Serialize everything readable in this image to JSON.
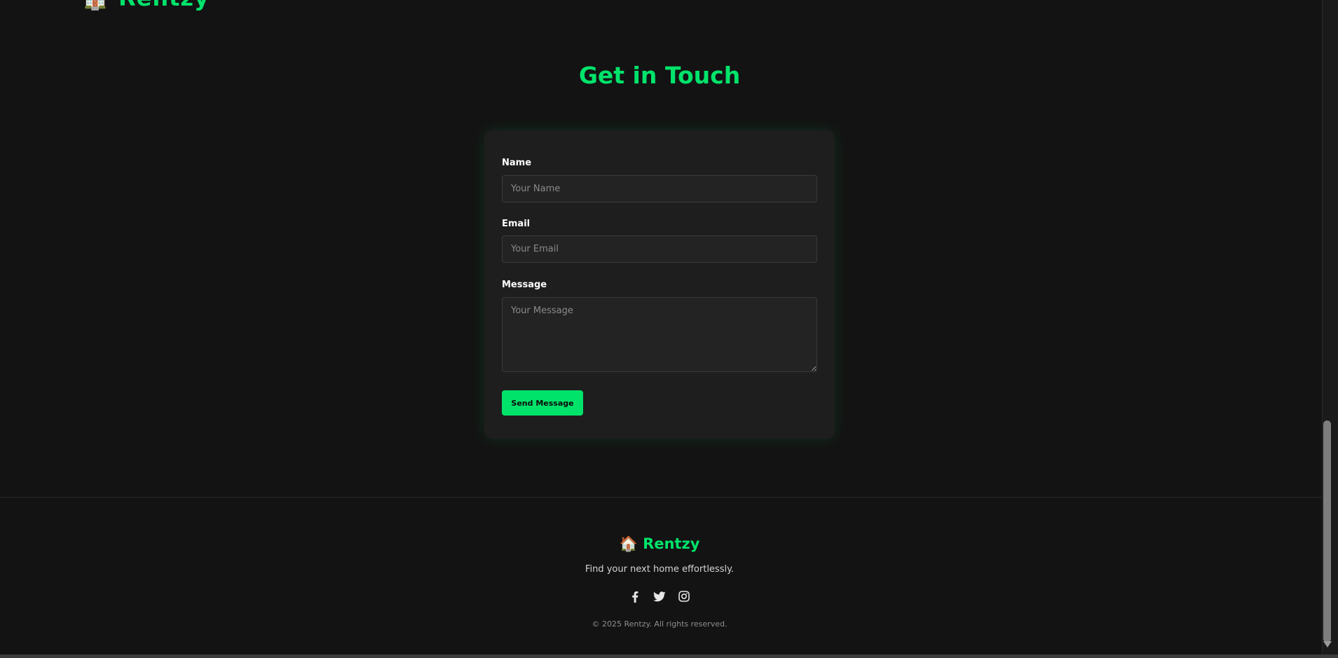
{
  "header": {
    "logo_fragment": "🏠 Rentzy"
  },
  "contact": {
    "title": "Get in Touch",
    "name_label": "Name",
    "name_placeholder": "Your Name",
    "email_label": "Email",
    "email_placeholder": "Your Email",
    "message_label": "Message",
    "message_placeholder": "Your Message",
    "send_label": "Send Message"
  },
  "footer": {
    "brand": "🏠 Rentzy",
    "tagline": "Find your next home effortlessly.",
    "socials": [
      "facebook-icon",
      "twitter-icon",
      "instagram-icon"
    ],
    "copyright": "© 2025 Rentzy. All rights reserved."
  },
  "colors": {
    "accent": "#00e36b",
    "background": "#131313",
    "card": "#1e1e1e"
  }
}
